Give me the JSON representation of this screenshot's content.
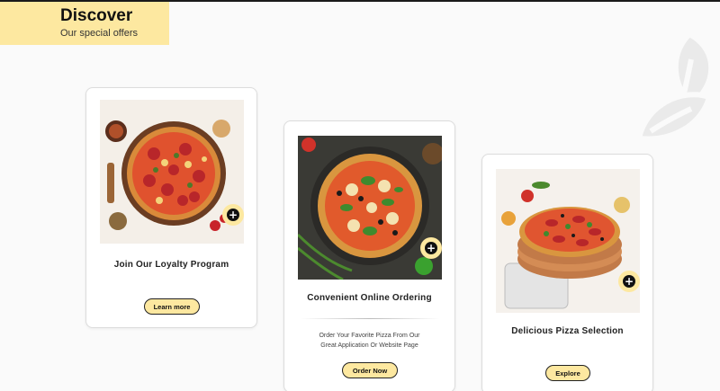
{
  "header": {
    "title": "Discover",
    "subtitle": "Our special offers"
  },
  "cards": [
    {
      "title": "Join Our Loyalty Program",
      "button": "Learn more",
      "image_alt": "pizza-top-view-photo",
      "add_icon": "plus-circle-icon"
    },
    {
      "title": "Convenient Online Ordering",
      "description": "Order Your Favorite Pizza From Our Great Application Or Website Page",
      "button": "Order Now",
      "image_alt": "pizza-with-vegetables-photo",
      "add_icon": "plus-circle-icon"
    },
    {
      "title": "Delicious Pizza Selection",
      "button": "Explore",
      "image_alt": "pizza-stack-with-phone-photo",
      "add_icon": "plus-circle-icon"
    }
  ],
  "colors": {
    "accent": "#fde8a0",
    "background": "#fafafa",
    "text": "#222222",
    "leaf_decoration": "#eaeaea"
  }
}
